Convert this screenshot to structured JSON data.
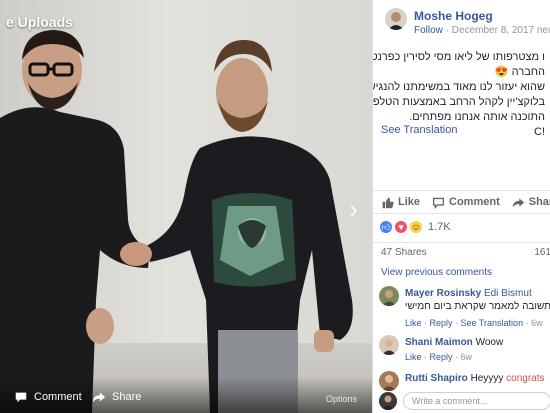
{
  "photo": {
    "album_title": "e Uploads",
    "comment_label": "Comment",
    "share_label": "Share",
    "options_label": "Options"
  },
  "post": {
    "author": "Moshe Hogeg",
    "follow_label": "Follow",
    "meta": " · December 8, 2017 near Barcel",
    "text_lines": [
      "ו מצטרפותו של ליאו מסי לסירין כפרנטור",
      "החברה 😍",
      "שהוא יעזור לנו מאוד במשימתנו להנגיש",
      "בלוקצ'יין לקהל הרחב באמצעות הטלפון",
      "התוכנה אותה אנחנו מפתחים.",
      "!C"
    ],
    "see_translation": "See Translation"
  },
  "actions": {
    "like": "Like",
    "comment": "Comment",
    "share": "Share"
  },
  "reactions": {
    "count": "1.7K"
  },
  "stats": {
    "shares": "47 Shares",
    "comments": "161"
  },
  "view_previous": "View previous comments",
  "comments": [
    {
      "name": "Mayer Rosinsky",
      "tag": "Edi Bismut",
      "text": "תשובה למאמר שקראת ביום חמישי",
      "like": "Like",
      "reply": "Reply",
      "see_translation": "See Translation",
      "time": "6w"
    },
    {
      "name": "Shani Maimon",
      "text": "Woow",
      "like": "Like",
      "reply": "Reply",
      "time": "6w"
    },
    {
      "name": "Rutti Shapiro",
      "text": "Heyyyy",
      "extra": "congrats"
    }
  ],
  "write_comment_placeholder": "Write a comment...",
  "colors": {
    "link": "#385898",
    "like_blue": "#4080ff",
    "love_red": "#f25268",
    "haha_yellow": "#f7d241",
    "congrats_red": "#e0483c"
  }
}
